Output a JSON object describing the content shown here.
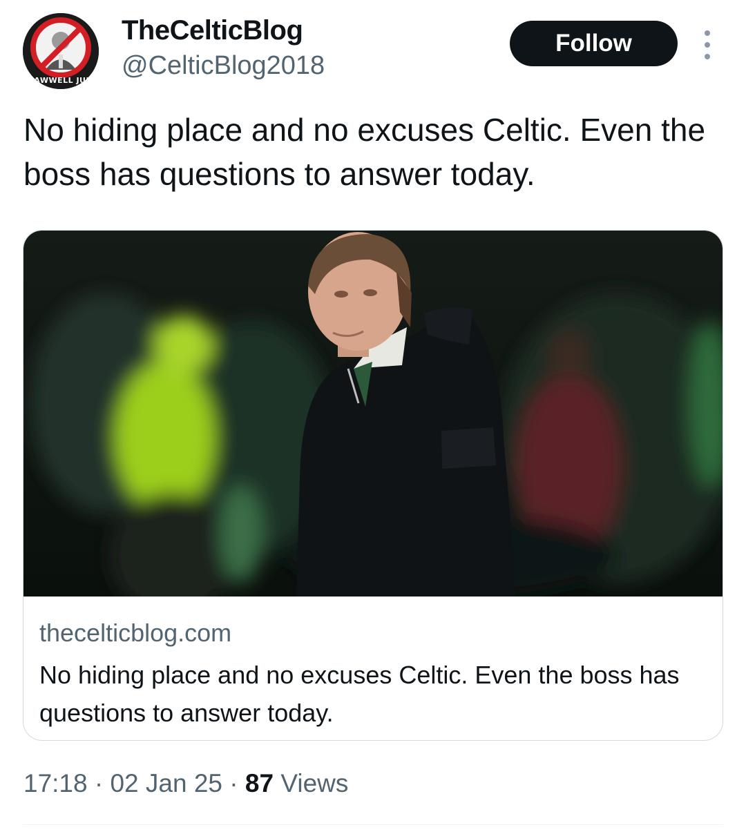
{
  "author": {
    "display_name": "TheCelticBlog",
    "handle": "@CelticBlog2018",
    "avatar_caption": "LAWWELL JUN"
  },
  "follow_label": "Follow",
  "more_icon": "more-vertical-icon",
  "tweet": {
    "text": "No hiding place and no excuses Celtic. Even the boss has questions to answer today."
  },
  "link_card": {
    "domain": "thecelticblog.com",
    "title": "No hiding place and no excuses Celtic. Even the boss has questions to answer today."
  },
  "meta": {
    "time": "17:18",
    "sep1": " · ",
    "date": "02 Jan 25",
    "sep2": " · ",
    "views_count": "87",
    "views_label": " Views"
  },
  "colors": {
    "text_primary": "#0f1419",
    "text_secondary": "#536471",
    "button_bg": "#0f1419",
    "border": "#cfd9de"
  }
}
